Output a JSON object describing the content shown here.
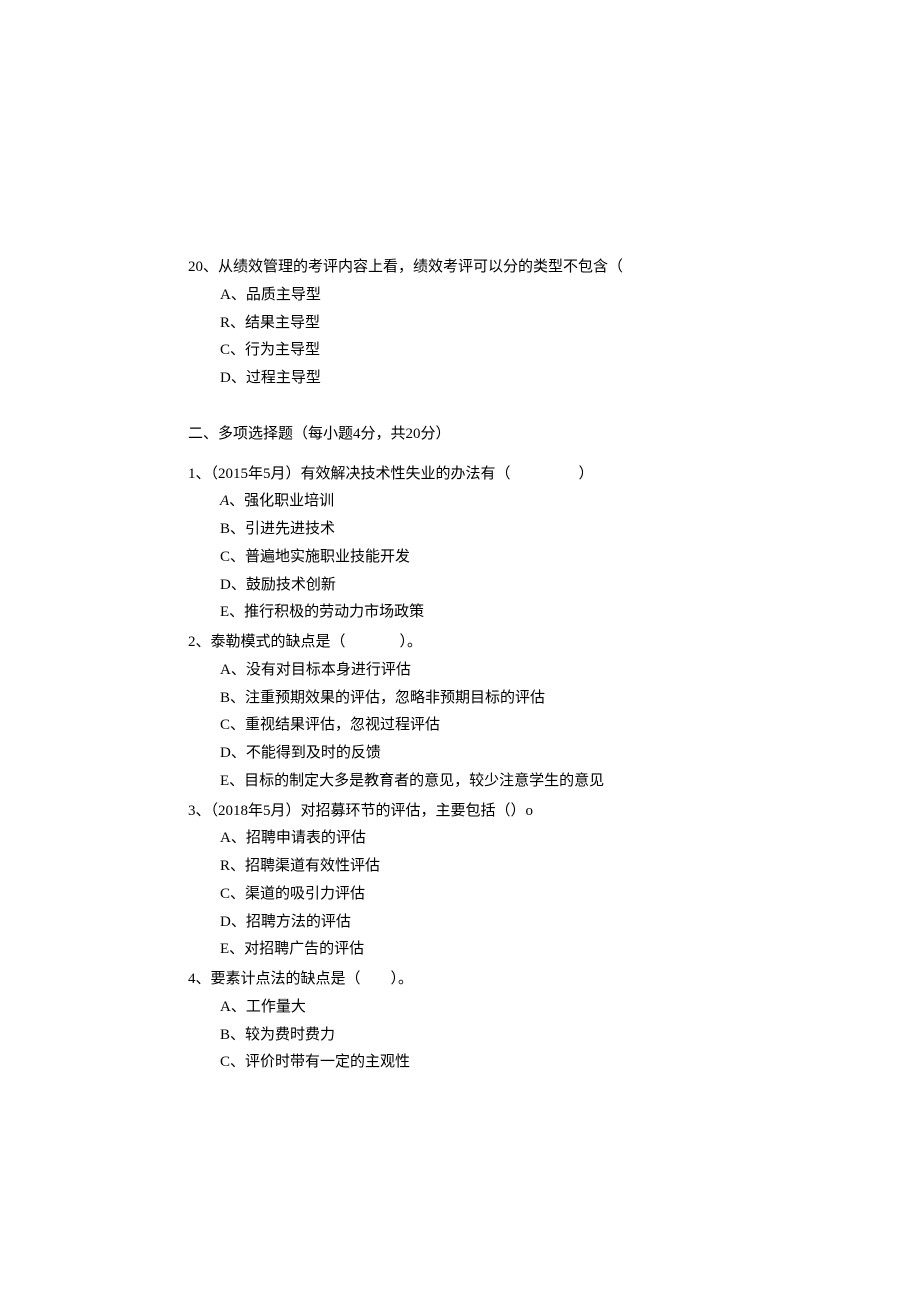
{
  "q20": {
    "stem": "20、从绩效管理的考评内容上看，绩效考评可以分的类型不包含（",
    "options": {
      "a": "A、品质主导型",
      "r": "R、结果主导型",
      "c": "C、行为主导型",
      "d": "D、过程主导型"
    }
  },
  "section2": {
    "header": "二、多项选择题（每小题4分，共20分）"
  },
  "mq1": {
    "stem_prefix": "1、（2015年5月）有效解决技术性失业的办法有（",
    "stem_suffix": "）",
    "options": {
      "a_prefix": "A",
      "a_text": "、强化职业培训",
      "b": "B、引进先进技术",
      "c": "C、普遍地实施职业技能开发",
      "d": "D、鼓励技术创新",
      "e": "E、推行积极的劳动力市场政策"
    }
  },
  "mq2": {
    "stem_prefix": "2、泰勒模式的缺点是（",
    "stem_suffix": "）。",
    "options": {
      "a": "A、没有对目标本身进行评估",
      "b": "B、注重预期效果的评估，忽略非预期目标的评估",
      "c": "C、重视结果评估，忽视过程评估",
      "d": "D、不能得到及时的反馈",
      "e": "E、目标的制定大多是教育者的意见，较少注意学生的意见"
    }
  },
  "mq3": {
    "stem": "3、（2018年5月）对招募环节的评估，主要包括（）o",
    "options": {
      "a": "A、招聘申请表的评估",
      "r": "R、招聘渠道有效性评估",
      "c": "C、渠道的吸引力评估",
      "d": "D、招聘方法的评估",
      "e": "E、对招聘广告的评估"
    }
  },
  "mq4": {
    "stem_prefix": "4、要素计点法的缺点是（",
    "stem_suffix": "）。",
    "options": {
      "a": "A、工作量大",
      "b": "B、较为费时费力",
      "c": "C、评价时带有一定的主观性"
    }
  }
}
